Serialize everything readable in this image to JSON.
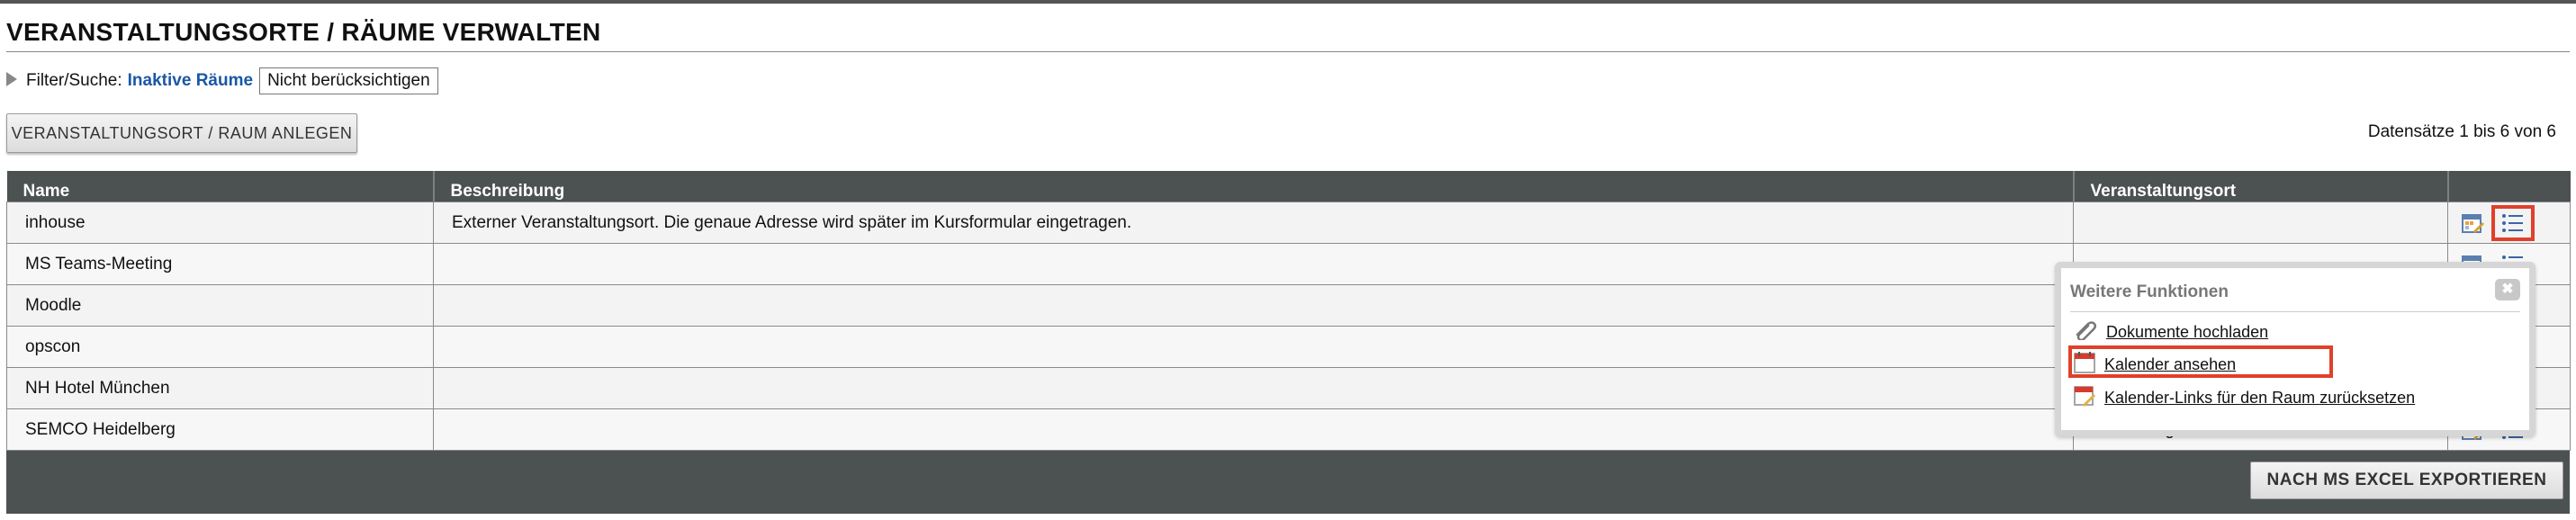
{
  "page": {
    "title": "VERANSTALTUNGSORTE / RÄUME VERWALTEN"
  },
  "filter": {
    "label": "Filter/Suche:",
    "value_label": "Inaktive Räume",
    "value": "Nicht berücksichtigen"
  },
  "toolbar": {
    "create_label": "VERANSTALTUNGSORT / RAUM ANLEGEN",
    "records_info": "Datensätze 1 bis 6 von 6"
  },
  "table": {
    "columns": [
      "Name",
      "Beschreibung",
      "Veranstaltungsort",
      ""
    ],
    "rows": [
      {
        "name": "inhouse",
        "description": "Externer Veranstaltungsort. Die genaue Adresse wird später im Kursformular eingetragen.",
        "location": ""
      },
      {
        "name": "MS Teams-Meeting",
        "description": "",
        "location": ""
      },
      {
        "name": "Moodle",
        "description": "",
        "location": ""
      },
      {
        "name": "opscon",
        "description": "",
        "location": ""
      },
      {
        "name": "NH Hotel München",
        "description": "",
        "location": ""
      },
      {
        "name": "SEMCO Heidelberg",
        "description": "",
        "location": "Heidelberg"
      }
    ],
    "export_label": "NACH MS EXCEL EXPORTIEREN"
  },
  "popup": {
    "title": "Weitere Funktionen",
    "close_symbol": "✖",
    "items": [
      {
        "label": "Dokumente hochladen",
        "icon": "paperclip-icon"
      },
      {
        "label": "Kalender ansehen",
        "icon": "calendar-icon"
      },
      {
        "label": "Kalender-Links für den Raum zurücksetzen",
        "icon": "calendar-edit-icon"
      }
    ]
  },
  "colors": {
    "header_bg": "#4c5152",
    "link_blue": "#1a57a6",
    "highlight_red": "#e0402a"
  }
}
